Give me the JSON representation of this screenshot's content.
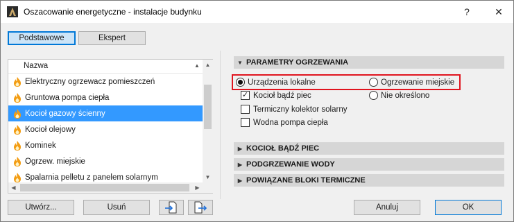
{
  "window": {
    "title": "Oszacowanie energetyczne - instalacje budynku",
    "help_glyph": "?",
    "close_glyph": "✕"
  },
  "modes": {
    "basic": "Podstawowe",
    "expert": "Ekspert"
  },
  "list": {
    "header": "Nazwa",
    "items": [
      {
        "label": "Elektryczny ogrzewacz pomieszczeń",
        "icon": "flame-icon"
      },
      {
        "label": "Gruntowa pompa ciepła",
        "icon": "flame-icon"
      },
      {
        "label": "Kocioł gazowy ścienny",
        "icon": "flame-icon",
        "selected": true
      },
      {
        "label": "Kocioł olejowy",
        "icon": "flame-icon"
      },
      {
        "label": "Kominek",
        "icon": "flame-icon"
      },
      {
        "label": "Ogrzew. miejskie",
        "icon": "flame-icon"
      },
      {
        "label": "Spalarnia pelletu z panelem solarnym",
        "icon": "flame-icon"
      }
    ]
  },
  "buttons": {
    "create": "Utwórz...",
    "delete": "Usuń",
    "cancel": "Anuluj",
    "ok": "OK"
  },
  "sections": {
    "heating_params": "PARAMETRY OGRZEWANIA",
    "boiler": "KOCIOŁ BĄDŹ PIEC",
    "water_heating": "PODGRZEWANIE WODY",
    "thermal_blocks": "POWIĄZANE BLOKI TERMICZNE"
  },
  "heating": {
    "radio_local": "Urządzenia lokalne",
    "radio_district": "Ogrzewanie miejskie",
    "radio_unspecified": "Nie określono",
    "selected_radio": "local",
    "check_boiler": "Kocioł bądź piec",
    "check_solar": "Termiczny kolektor solarny",
    "check_heatpump": "Wodna pompa ciepła",
    "boiler_checked": true,
    "checkmark": "✓"
  },
  "colors": {
    "selection": "#3399ff",
    "highlight_border": "#e0141e",
    "active_mode_border": "#0078d7",
    "flame": "#f39c12"
  }
}
